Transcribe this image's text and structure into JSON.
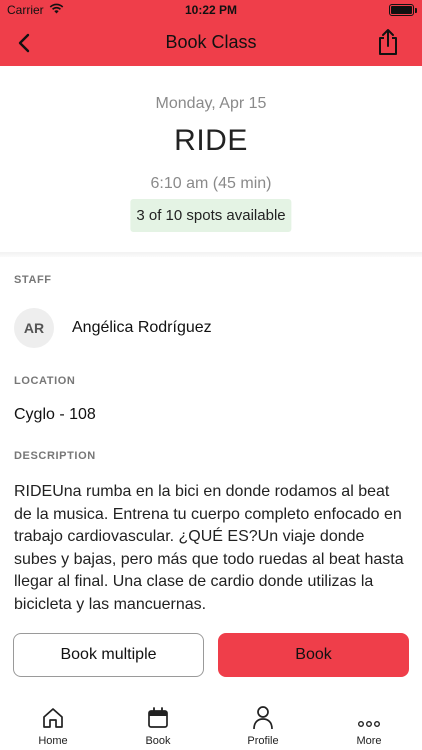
{
  "status_bar": {
    "carrier": "Carrier",
    "time": "10:22 PM",
    "battery_level": 1.0
  },
  "nav": {
    "title": "Book Class",
    "back_icon": "chevron-left-icon",
    "share_icon": "share-icon"
  },
  "class_info": {
    "date": "Monday, Apr 15",
    "name": "RIDE",
    "time_range": "6:10 am (45 min)",
    "spots": "3 of 10 spots available"
  },
  "staff": {
    "label": "STAFF",
    "initials": "AR",
    "name": "Angélica Rodríguez"
  },
  "location": {
    "label": "LOCATION",
    "value": "Cyglo - 108"
  },
  "description": {
    "label": "DESCRIPTION",
    "text": "RIDEUna rumba en la bici en donde rodamos al beat de la musica. Entrena tu cuerpo completo enfocado en trabajo cardiovascular. ¿QUÉ ES?Un viaje donde subes y bajas, pero más que todo ruedas al beat hasta llegar al final. Una clase de cardio donde utilizas la bicicleta y las mancuernas."
  },
  "actions": {
    "book_multiple": "Book multiple",
    "book": "Book"
  },
  "tabs": [
    {
      "label": "Home",
      "icon": "home-icon"
    },
    {
      "label": "Book",
      "icon": "calendar-icon",
      "active": true
    },
    {
      "label": "Profile",
      "icon": "person-icon"
    },
    {
      "label": "More",
      "icon": "more-icon"
    }
  ],
  "colors": {
    "accent": "#ef3e4a",
    "spots_bg": "#e4f3e4",
    "muted_text": "#8a8a8a"
  }
}
